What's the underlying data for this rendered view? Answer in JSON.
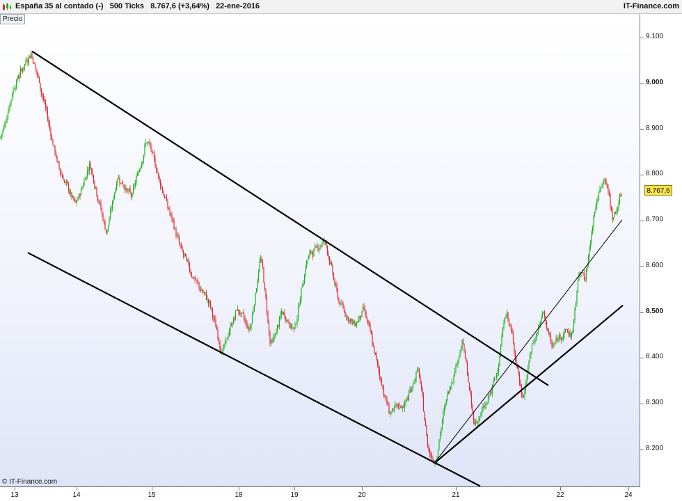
{
  "titlebar": {
    "title": "España 35 al contado (-)   500 Ticks   8.767,6 (+3,64%)   22-ene-2016",
    "brand": "IT-Finance.com"
  },
  "panel_label": "Precio",
  "copyright": "© IT-Finance.com",
  "colors": {
    "up": "#19b319",
    "down": "#e0252b",
    "trendline": "#000000",
    "price_tag": "#f5e34a"
  },
  "icons": [
    "candlestick-chart-icon"
  ],
  "chart_data": {
    "type": "candlestick",
    "title": "",
    "y_ticks": [
      "9.100",
      "9.000",
      "8.900",
      "8.800",
      "8.700",
      "8.600",
      "8.500",
      "8.400",
      "8.300",
      "8.200"
    ],
    "y_tick_bold": [
      "9.000",
      "8.500"
    ],
    "ylim": [
      8120,
      9150
    ],
    "x_ticks": [
      "13",
      "14",
      "15",
      "18",
      "19",
      "20",
      "21",
      "22",
      "24"
    ],
    "last_price_label": "8.767,6",
    "last_price": 8767.6,
    "series_path": [
      [
        0,
        8880
      ],
      [
        20,
        9000
      ],
      [
        44,
        9070
      ],
      [
        62,
        8960
      ],
      [
        82,
        8820
      ],
      [
        108,
        8730
      ],
      [
        128,
        8830
      ],
      [
        152,
        8670
      ],
      [
        168,
        8800
      ],
      [
        188,
        8750
      ],
      [
        210,
        8880
      ],
      [
        232,
        8770
      ],
      [
        258,
        8640
      ],
      [
        282,
        8560
      ],
      [
        300,
        8520
      ],
      [
        318,
        8410
      ],
      [
        340,
        8510
      ],
      [
        358,
        8460
      ],
      [
        374,
        8630
      ],
      [
        388,
        8420
      ],
      [
        404,
        8500
      ],
      [
        422,
        8460
      ],
      [
        440,
        8620
      ],
      [
        466,
        8660
      ],
      [
        486,
        8520
      ],
      [
        508,
        8470
      ],
      [
        522,
        8510
      ],
      [
        540,
        8390
      ],
      [
        558,
        8280
      ],
      [
        582,
        8300
      ],
      [
        600,
        8380
      ],
      [
        614,
        8200
      ],
      [
        624,
        8170
      ],
      [
        640,
        8310
      ],
      [
        664,
        8440
      ],
      [
        680,
        8250
      ],
      [
        698,
        8300
      ],
      [
        712,
        8360
      ],
      [
        726,
        8510
      ],
      [
        738,
        8420
      ],
      [
        750,
        8300
      ],
      [
        762,
        8420
      ],
      [
        780,
        8500
      ],
      [
        792,
        8420
      ],
      [
        808,
        8460
      ],
      [
        822,
        8450
      ],
      [
        832,
        8610
      ],
      [
        840,
        8560
      ],
      [
        852,
        8720
      ],
      [
        868,
        8800
      ],
      [
        880,
        8700
      ],
      [
        894,
        8770
      ]
    ],
    "trend_lines": [
      {
        "from": [
          46,
          9070
        ],
        "to": [
          788,
          8340
        ],
        "weight": "thick"
      },
      {
        "from": [
          40,
          8630
        ],
        "to": [
          690,
          8120
        ],
        "weight": "thick"
      },
      {
        "from": [
          624,
          8170
        ],
        "to": [
          895,
          8515
        ],
        "weight": "thick"
      },
      {
        "from": [
          624,
          8170
        ],
        "to": [
          894,
          8702
        ],
        "weight": "thin"
      }
    ]
  }
}
